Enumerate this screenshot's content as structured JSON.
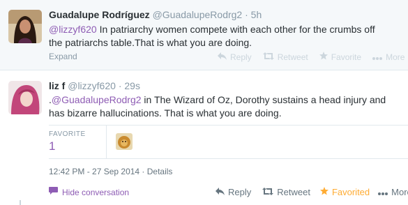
{
  "tweet1": {
    "fullname": "Guadalupe Rodríguez",
    "handle": "@GuadalupeRodrg2",
    "separator": "·",
    "time": "5h",
    "mention": "@lizzyf620",
    "text": " In patriarchy women compete with each other for the crumbs off the patriarchs table.That is what you are doing.",
    "expand_label": "Expand",
    "actions": {
      "reply": "Reply",
      "retweet": "Retweet",
      "favorite": "Favorite",
      "more": "More"
    }
  },
  "tweet2": {
    "fullname": "liz f",
    "handle": "@lizzyf620",
    "separator": "·",
    "time": "29s",
    "prefix": ".",
    "mention": "@GuadalupeRodrg2",
    "text": " in The Wizard of Oz, Dorothy sustains a head injury and has bizarre hallucinations. That is what you are doing.",
    "stats": {
      "label": "FAVORITE",
      "value": "1"
    },
    "datetime": "12:42 PM - 27 Sep 2014 · Details",
    "hide_conversation": "Hide conversation",
    "actions": {
      "reply": "Reply",
      "retweet": "Retweet",
      "favorited": "Favorited",
      "more": "More"
    }
  },
  "colors": {
    "link": "#8e5cb4",
    "favorited": "#ffac33",
    "muted": "#8899a6",
    "background_parent": "#f5f8fa"
  },
  "icons": [
    "reply-icon",
    "retweet-icon",
    "star-icon",
    "more-dots-icon",
    "conversation-bubble-icon"
  ]
}
